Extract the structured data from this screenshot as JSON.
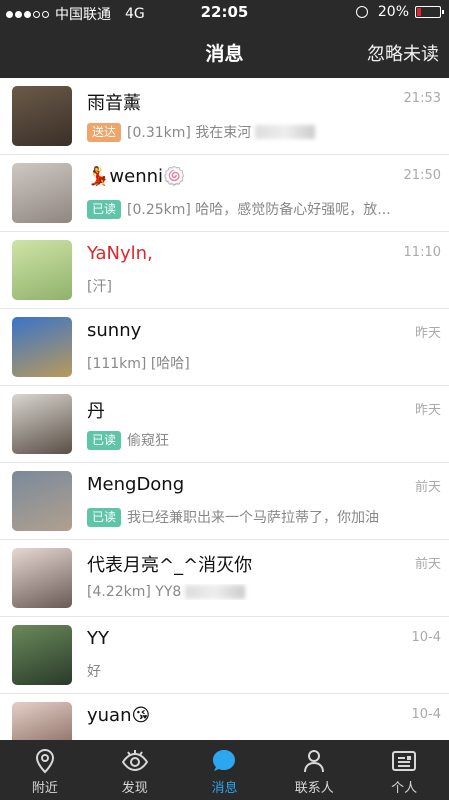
{
  "status_bar": {
    "carrier": "中国联通",
    "network": "4G",
    "time": "22:05",
    "battery": "20%",
    "battery_level": 0.2
  },
  "nav": {
    "title": "消息",
    "right_action": "忽略未读"
  },
  "conversations": [
    {
      "name": "雨音薰",
      "time": "21:53",
      "tag": "送达",
      "tag_color": "#f0a46a",
      "preview": "[0.31km] 我在束河",
      "name_color": "#111111",
      "avatar_colors": [
        "#6b5a48",
        "#3a3028"
      ]
    },
    {
      "name": "wenni",
      "name_emoji_before": "💃",
      "name_emoji_after": "🍥",
      "time": "21:50",
      "tag": "已读",
      "tag_color": "#5ec5a8",
      "preview": "[0.25km] 哈哈，感觉防备心好强呢，放...",
      "name_color": "#111111",
      "avatar_colors": [
        "#cfc8c2",
        "#8f8680"
      ]
    },
    {
      "name": "YaNyln,",
      "time": "11:10",
      "tag": "",
      "preview": "[汗]",
      "name_color": "#e0262b",
      "avatar_colors": [
        "#cfe3a8",
        "#8fb36a"
      ]
    },
    {
      "name": "sunny",
      "time": "昨天",
      "tag": "",
      "preview": "[111km] [哈哈]",
      "name_color": "#111111",
      "avatar_colors": [
        "#3a74c8",
        "#b89a5c"
      ]
    },
    {
      "name": "丹",
      "time": "昨天",
      "tag": "已读",
      "tag_color": "#5ec5a8",
      "preview": "偷窥狂",
      "name_color": "#111111",
      "avatar_colors": [
        "#d8d6cf",
        "#5a4f46"
      ]
    },
    {
      "name": "MengDong",
      "time": "前天",
      "tag": "已读",
      "tag_color": "#5ec5a8",
      "preview": "我已经兼职出来一个马萨拉蒂了，你加油",
      "name_color": "#111111",
      "avatar_colors": [
        "#7a8a9a",
        "#b0a090"
      ]
    },
    {
      "name": "代表月亮^_^消灭你",
      "time": "前天",
      "tag": "",
      "preview": "[4.22km] YY8",
      "name_color": "#111111",
      "avatar_colors": [
        "#e8d8d4",
        "#6a5a56"
      ]
    },
    {
      "name": "YY",
      "time": "10-4",
      "tag": "",
      "preview": "好",
      "name_color": "#111111",
      "avatar_colors": [
        "#6a8a5a",
        "#2a3a2a"
      ]
    },
    {
      "name": "yuan",
      "name_emoji_after": "😘",
      "time": "10-4",
      "tag": "",
      "preview": "",
      "name_color": "#111111",
      "avatar_colors": [
        "#e4d0c8",
        "#7a5a50"
      ]
    }
  ],
  "tabs": [
    {
      "label": "附近",
      "icon": "location-pin-icon",
      "active": false
    },
    {
      "label": "发现",
      "icon": "eye-icon",
      "active": false
    },
    {
      "label": "消息",
      "icon": "chat-bubble-icon",
      "active": true
    },
    {
      "label": "联系人",
      "icon": "person-icon",
      "active": false
    },
    {
      "label": "个人",
      "icon": "id-card-icon",
      "active": false
    }
  ],
  "colors": {
    "bar_bg": "#2a2a2a",
    "accent": "#2da6f0",
    "red": "#e0262b"
  }
}
